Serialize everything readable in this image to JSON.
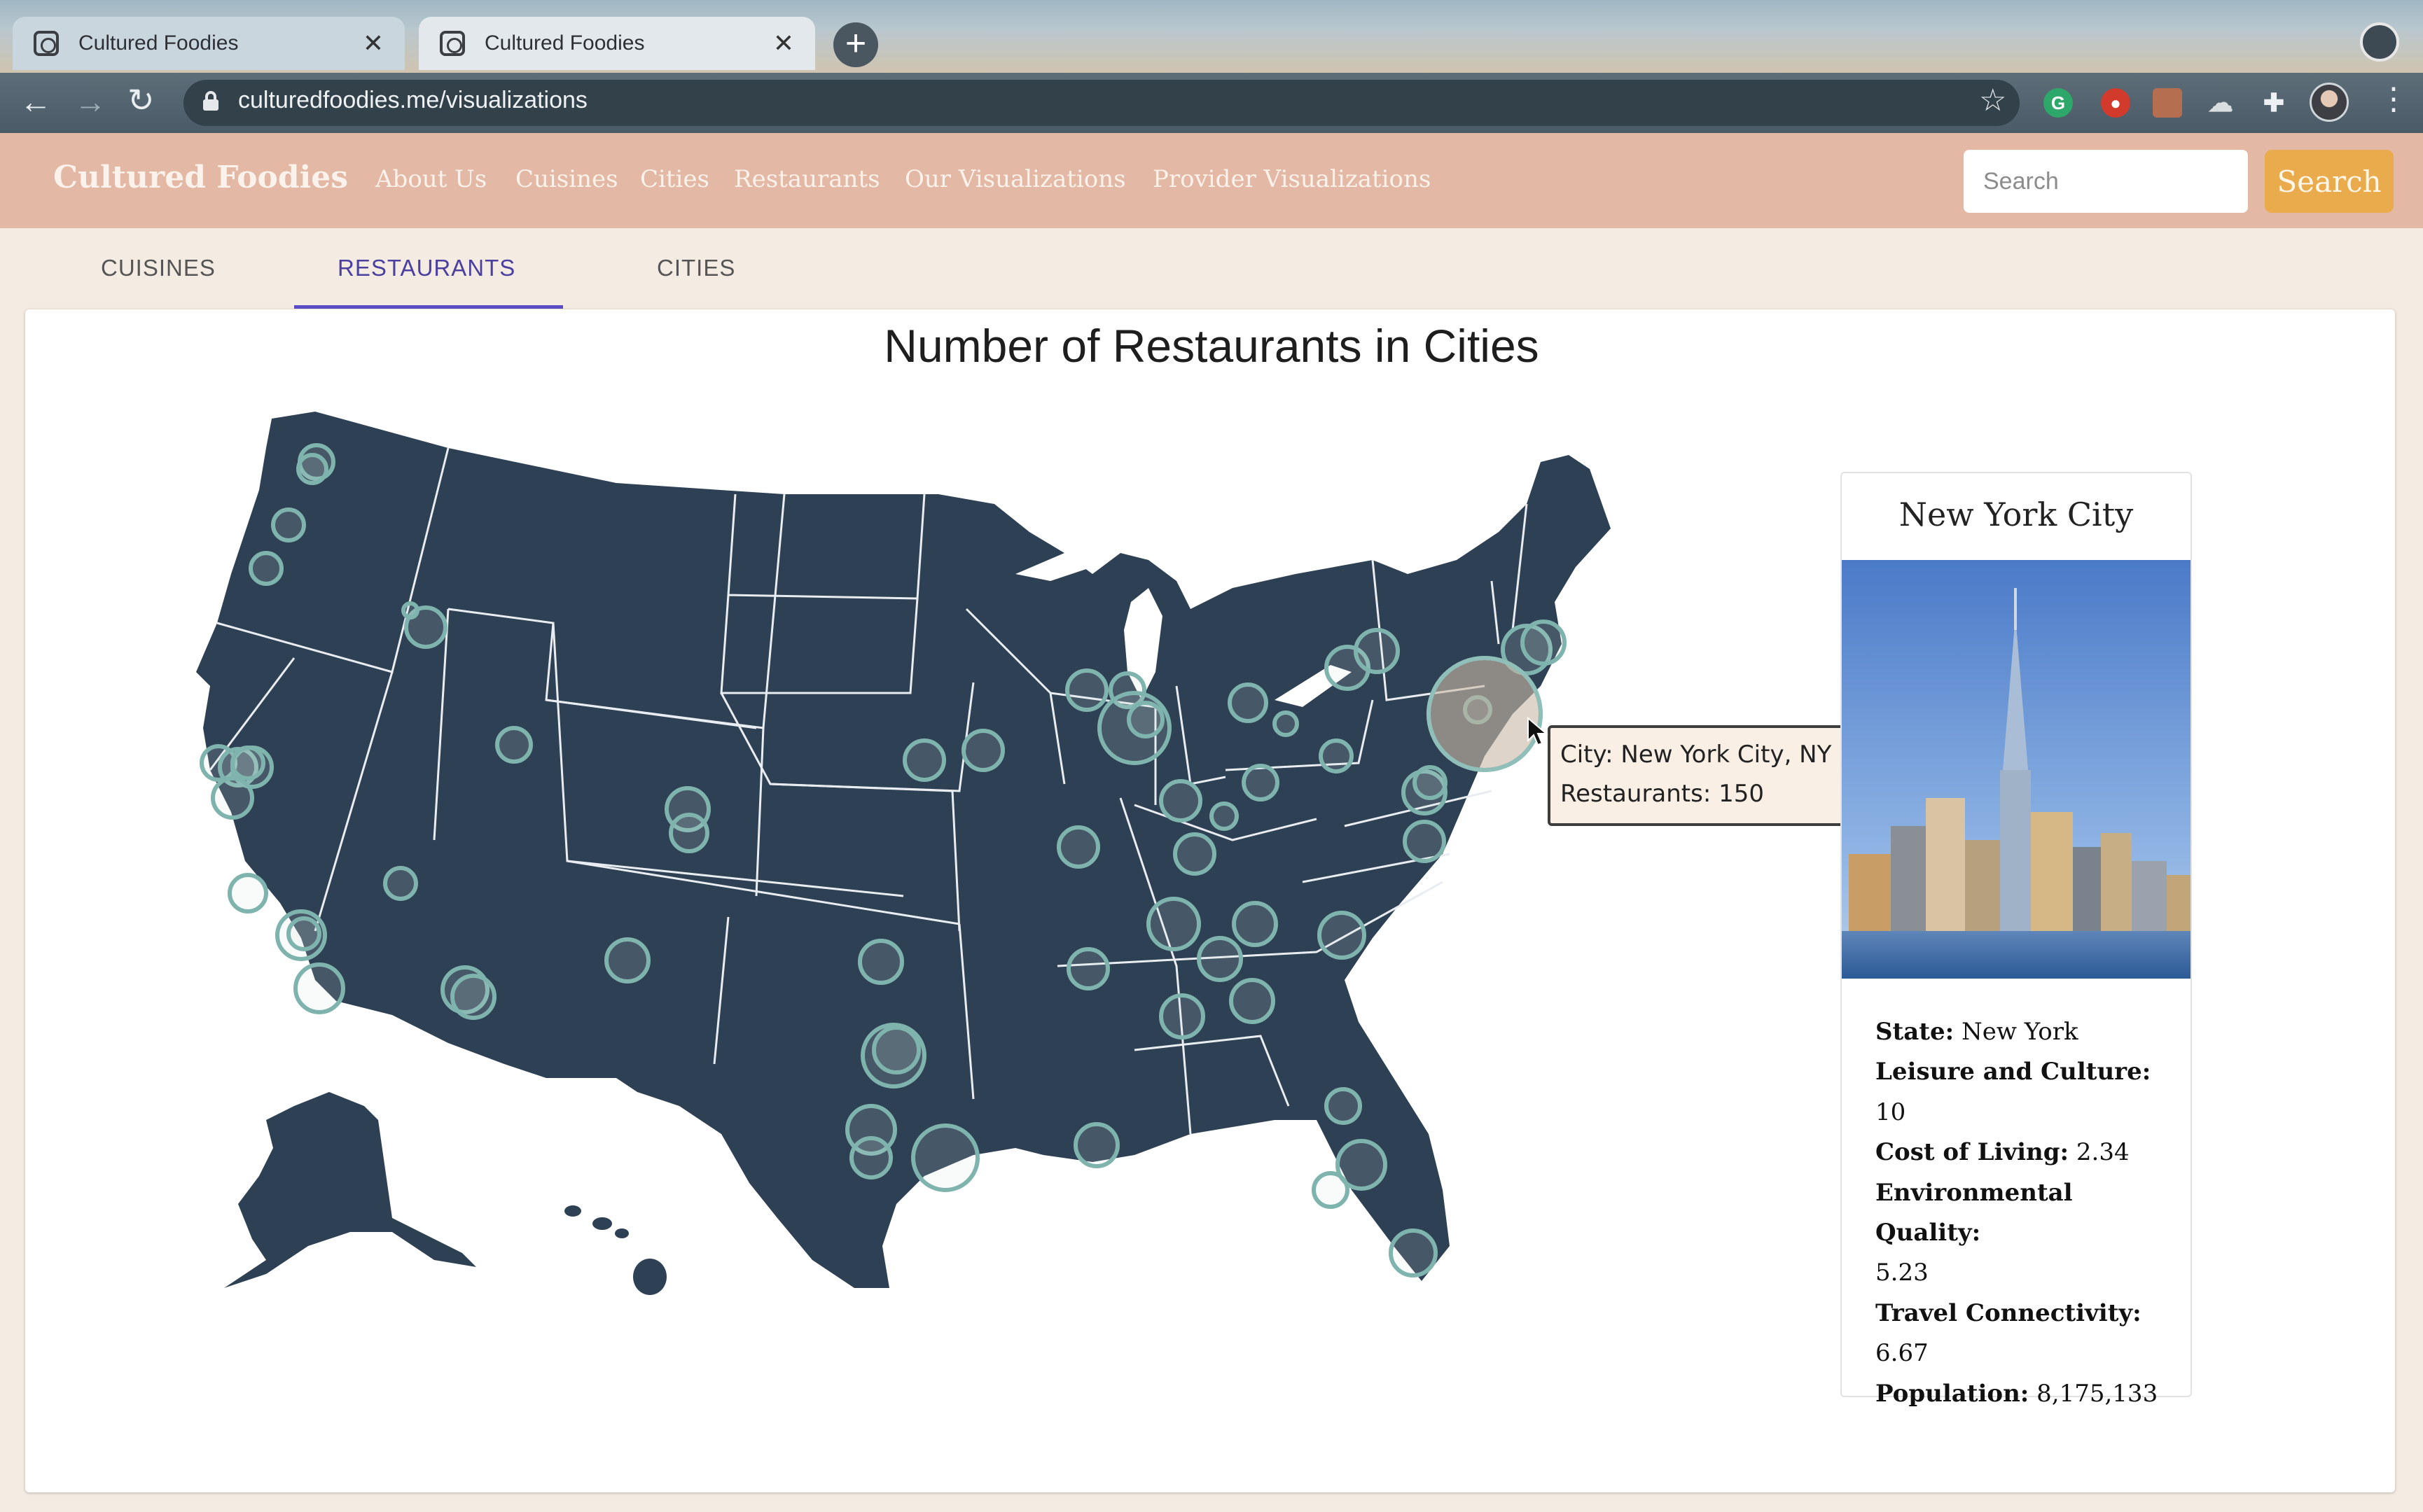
{
  "browser": {
    "tabs": [
      {
        "title": "Cultured Foodies"
      },
      {
        "title": "Cultured Foodies"
      }
    ],
    "url": "culturedfoodies.me/visualizations"
  },
  "navbar": {
    "brand": "Cultured Foodies",
    "links": [
      "About Us",
      "Cuisines",
      "Cities",
      "Restaurants",
      "Our Visualizations",
      "Provider Visualizations"
    ],
    "search_placeholder": "Search",
    "search_button": "Search"
  },
  "viz_tabs": [
    "CUISINES",
    "RESTAURANTS",
    "CITIES"
  ],
  "active_tab": "RESTAURANTS",
  "chart_title": "Number of Restaurants in Cities",
  "tooltip": {
    "line1": "City: New York City, NY",
    "line2": "Restaurants: 150"
  },
  "city_card": {
    "name": "New York City",
    "fields": [
      {
        "label": "State:",
        "value": "New York"
      },
      {
        "label": "Leisure and Culture:",
        "value": "10"
      },
      {
        "label": "Cost of Living:",
        "value": "2.34"
      },
      {
        "label": "Environmental Quality:",
        "value": "5.23"
      },
      {
        "label": "Travel Connectivity:",
        "value": "6.67"
      },
      {
        "label": "Population:",
        "value": "8,175,133"
      }
    ]
  },
  "colors": {
    "nav_bg": "#e3b8a4",
    "search_button": "#e9ab4c",
    "map_fill": "#2e4053",
    "bubble_stroke": "#7fb3ad",
    "active_tab": "#5b4cc6"
  },
  "chart_data": {
    "type": "scatter",
    "title": "Number of Restaurants in Cities",
    "points": [
      {
        "city": "New York City, NY",
        "restaurants": 150
      }
    ]
  }
}
